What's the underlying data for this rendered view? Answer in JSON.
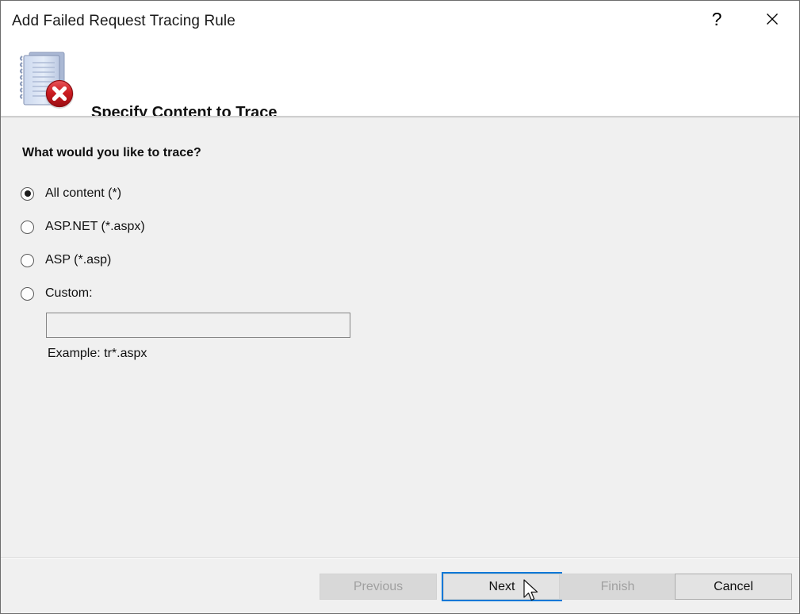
{
  "window": {
    "title": "Add Failed Request Tracing Rule",
    "help_glyph": "?",
    "close_glyph": "✕",
    "help_name": "help-button",
    "close_name": "close-button"
  },
  "header": {
    "heading": "Specify Content to Trace",
    "icon": "log-document-error-icon"
  },
  "body": {
    "question": "What would you like to trace?",
    "options": [
      {
        "label": "All content (*)",
        "checked": true
      },
      {
        "label": "ASP.NET (*.aspx)",
        "checked": false
      },
      {
        "label": "ASP (*.asp)",
        "checked": false
      },
      {
        "label": "Custom:",
        "checked": false
      }
    ],
    "custom_input": {
      "value": "",
      "placeholder": "",
      "enabled": false
    },
    "example_text": "Example: tr*.aspx"
  },
  "footer": {
    "buttons": [
      {
        "label": "Previous",
        "enabled": false,
        "focused": false
      },
      {
        "label": "Next",
        "enabled": true,
        "focused": true
      },
      {
        "label": "Finish",
        "enabled": false,
        "focused": false
      },
      {
        "label": "Cancel",
        "enabled": true,
        "focused": false
      }
    ]
  },
  "colors": {
    "accent_focus": "#0078d7",
    "dialog_background": "#f0f0f0",
    "header_background": "#ffffff",
    "error_badge": "#c5181f"
  }
}
